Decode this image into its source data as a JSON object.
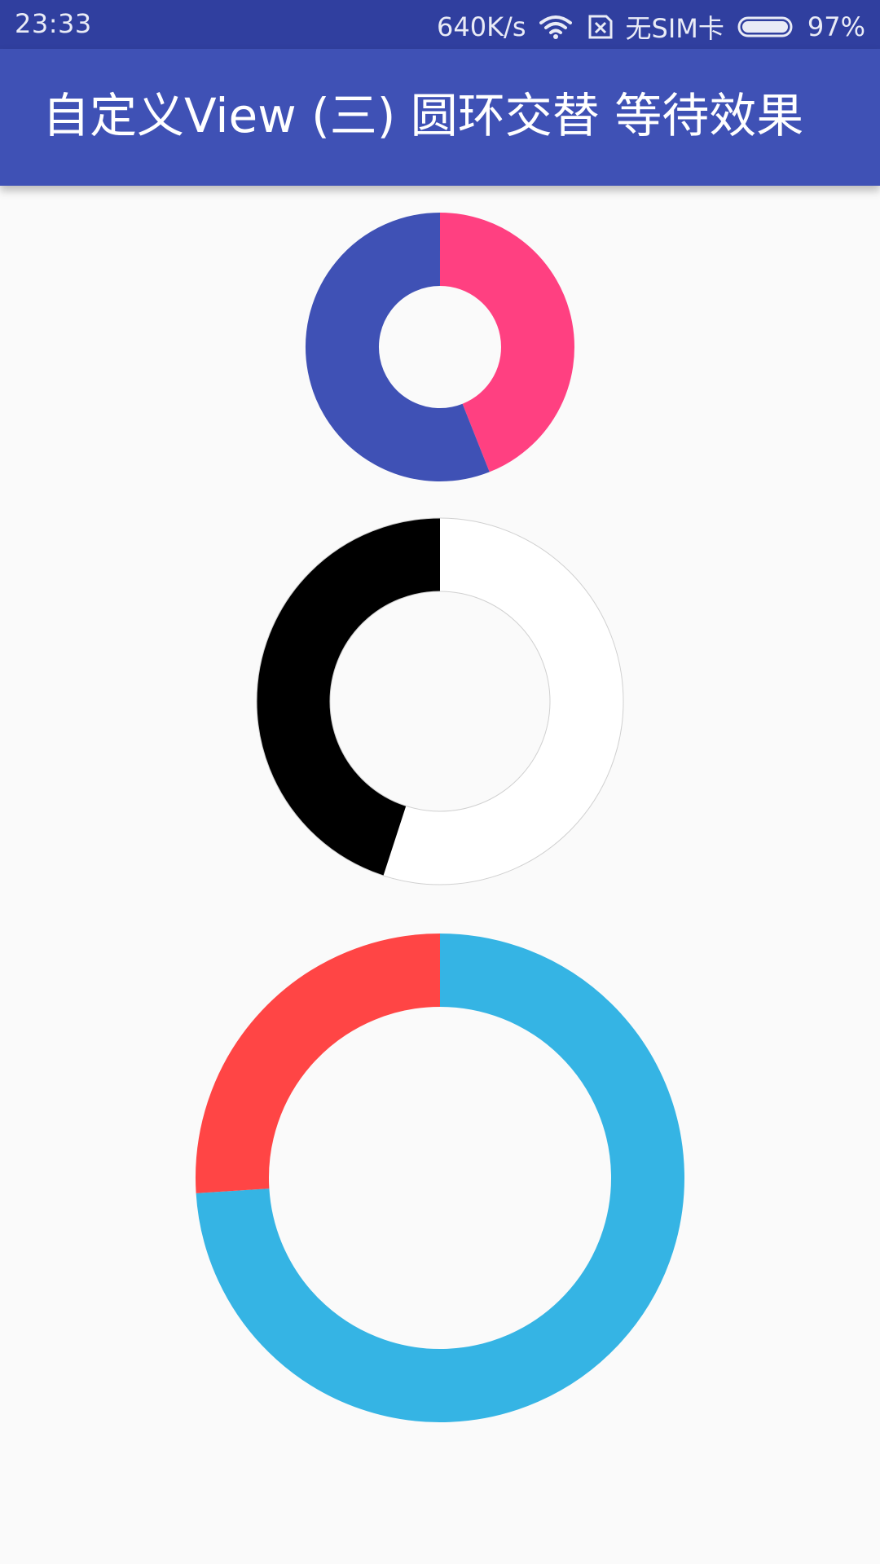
{
  "status_bar": {
    "time": "23:33",
    "net_speed": "640K/s",
    "carrier": "无SIM卡",
    "battery_percent": "97%",
    "icons": [
      "wifi-icon",
      "no-sim-icon",
      "battery-icon"
    ]
  },
  "app_bar": {
    "title": "自定义View (三) 圆环交替 等待效果"
  },
  "rings": [
    {
      "name": "ring-small",
      "first_color": "#ff4081",
      "second_color": "#3f51b5",
      "progress_fraction": 0.44
    },
    {
      "name": "ring-medium",
      "first_color": "#ffffff",
      "second_color": "#000000",
      "progress_fraction": 0.55
    },
    {
      "name": "ring-large",
      "first_color": "#35b4e4",
      "second_color": "#ff4545",
      "progress_fraction": 0.74
    }
  ],
  "colors": {
    "status_bar": "#303f9f",
    "app_bar": "#3f51b5",
    "background": "#fafafa"
  }
}
